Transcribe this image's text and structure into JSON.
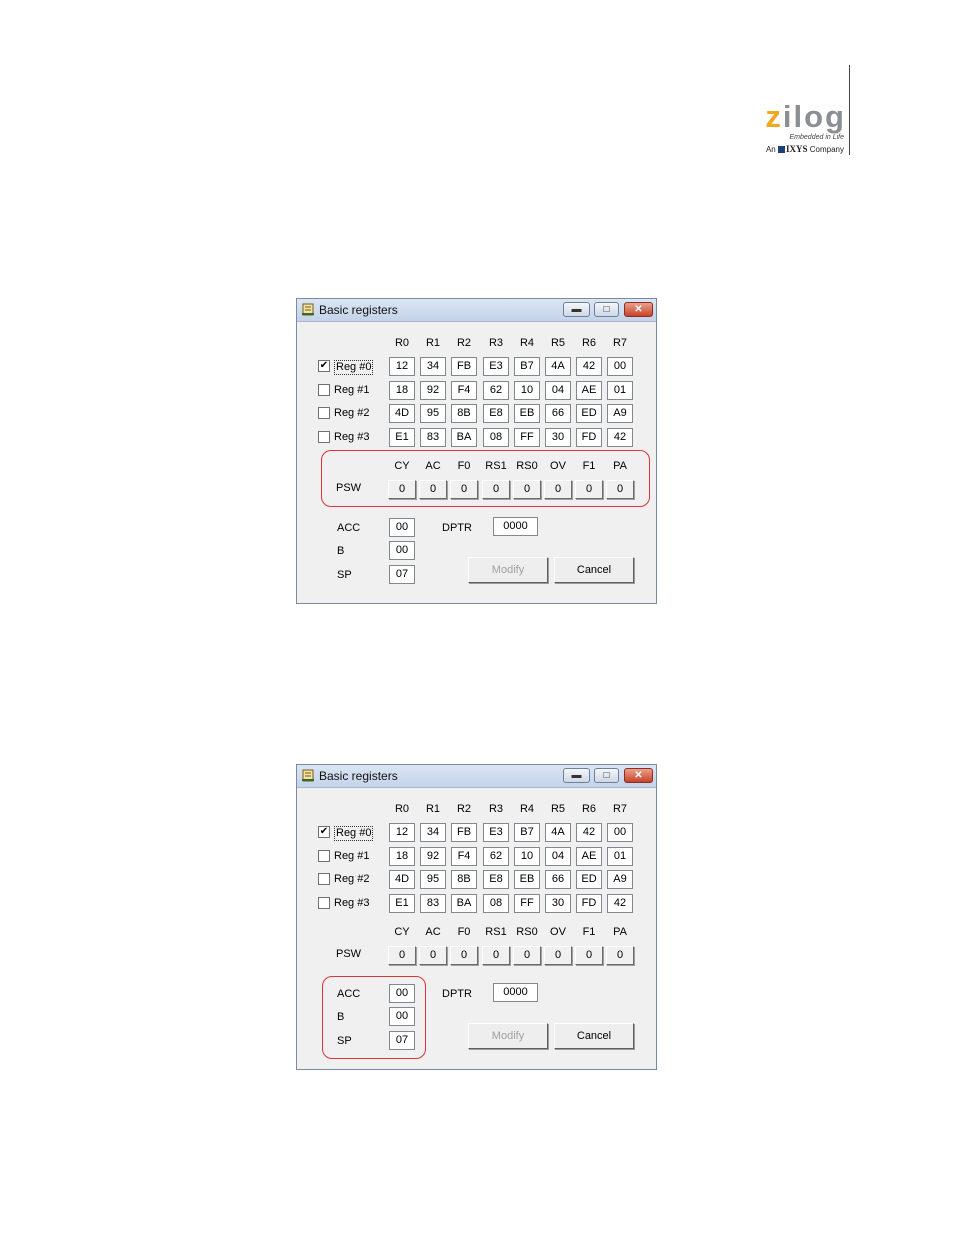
{
  "logo": {
    "brand": "zilog",
    "tagline": "Embedded in Life",
    "parent_prefix": "An",
    "parent_name": "IXYS",
    "parent_suffix": "Company"
  },
  "dialogs": [
    {
      "title": "Basic registers",
      "highlight": "PSW",
      "columns": [
        "R0",
        "R1",
        "R2",
        "R3",
        "R4",
        "R5",
        "R6",
        "R7"
      ],
      "banks": [
        {
          "label": "Reg #0",
          "checked": true,
          "values": [
            "12",
            "34",
            "FB",
            "E3",
            "B7",
            "4A",
            "42",
            "00"
          ]
        },
        {
          "label": "Reg #1",
          "checked": false,
          "values": [
            "18",
            "92",
            "F4",
            "62",
            "10",
            "04",
            "AE",
            "01"
          ]
        },
        {
          "label": "Reg #2",
          "checked": false,
          "values": [
            "4D",
            "95",
            "8B",
            "E8",
            "EB",
            "66",
            "ED",
            "A9"
          ]
        },
        {
          "label": "Reg #3",
          "checked": false,
          "values": [
            "E1",
            "83",
            "BA",
            "08",
            "FF",
            "30",
            "FD",
            "42"
          ]
        }
      ],
      "psw_label": "PSW",
      "psw_flags": [
        "CY",
        "AC",
        "F0",
        "RS1",
        "RS0",
        "OV",
        "F1",
        "PA"
      ],
      "psw_values": [
        "0",
        "0",
        "0",
        "0",
        "0",
        "0",
        "0",
        "0"
      ],
      "acc_label": "ACC",
      "acc": "00",
      "b_label": "B",
      "b": "00",
      "sp_label": "SP",
      "sp": "07",
      "dptr_label": "DPTR",
      "dptr": "0000",
      "modify_label": "Modify",
      "cancel_label": "Cancel"
    },
    {
      "title": "Basic registers",
      "highlight": "ACC-B-SP",
      "columns": [
        "R0",
        "R1",
        "R2",
        "R3",
        "R4",
        "R5",
        "R6",
        "R7"
      ],
      "banks": [
        {
          "label": "Reg #0",
          "checked": true,
          "values": [
            "12",
            "34",
            "FB",
            "E3",
            "B7",
            "4A",
            "42",
            "00"
          ]
        },
        {
          "label": "Reg #1",
          "checked": false,
          "values": [
            "18",
            "92",
            "F4",
            "62",
            "10",
            "04",
            "AE",
            "01"
          ]
        },
        {
          "label": "Reg #2",
          "checked": false,
          "values": [
            "4D",
            "95",
            "8B",
            "E8",
            "EB",
            "66",
            "ED",
            "A9"
          ]
        },
        {
          "label": "Reg #3",
          "checked": false,
          "values": [
            "E1",
            "83",
            "BA",
            "08",
            "FF",
            "30",
            "FD",
            "42"
          ]
        }
      ],
      "psw_label": "PSW",
      "psw_flags": [
        "CY",
        "AC",
        "F0",
        "RS1",
        "RS0",
        "OV",
        "F1",
        "PA"
      ],
      "psw_values": [
        "0",
        "0",
        "0",
        "0",
        "0",
        "0",
        "0",
        "0"
      ],
      "acc_label": "ACC",
      "acc": "00",
      "b_label": "B",
      "b": "00",
      "sp_label": "SP",
      "sp": "07",
      "dptr_label": "DPTR",
      "dptr": "0000",
      "modify_label": "Modify",
      "cancel_label": "Cancel"
    }
  ],
  "colors": {
    "highlight": "#d8343a",
    "window_bg": "#f0f0f0",
    "logo_accent": "#f2a81d"
  }
}
